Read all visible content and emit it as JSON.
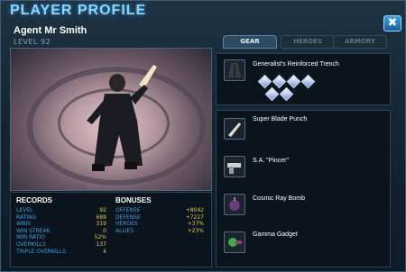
{
  "header": {
    "title": "PLAYER PROFILE",
    "close_label": "✖"
  },
  "agent": {
    "name": "Agent Mr Smith",
    "level": "LEVEL 92"
  },
  "tabs": [
    {
      "label": "GEAR",
      "active": true
    },
    {
      "label": "HEROES",
      "active": false
    },
    {
      "label": "ARMORY",
      "active": false
    }
  ],
  "records": {
    "heading": "RECORDS",
    "rows": [
      {
        "label": "LEVEL",
        "value": "92"
      },
      {
        "label": "RATING",
        "value": "689"
      },
      {
        "label": "WINS",
        "value": "319"
      },
      {
        "label": "WIN STREAK",
        "value": "0"
      },
      {
        "label": "WIN RATIO",
        "value": "52%"
      },
      {
        "label": "OVERKILLS",
        "value": "137"
      },
      {
        "label": "TRIPLE OVERKILLS",
        "value": "4"
      }
    ]
  },
  "bonuses": {
    "heading": "BONUSES",
    "rows": [
      {
        "label": "OFFENSE",
        "value": "+8042"
      },
      {
        "label": "DEFENSE",
        "value": "+7227"
      },
      {
        "label": "HEROES",
        "value": "+37%"
      },
      {
        "label": "ALLIES",
        "value": "+23%"
      }
    ]
  },
  "gear": {
    "armor": {
      "name": "Generalist's Reinforced Trench",
      "icon": "trench-coat-icon",
      "gems": 6
    },
    "items": [
      {
        "name": "Super Blade Punch",
        "icon": "blade-icon"
      },
      {
        "name": "S.A. \"Pincer\"",
        "icon": "pistol-icon"
      },
      {
        "name": "Cosmic Ray Bomb",
        "icon": "bomb-icon"
      },
      {
        "name": "Gamma Gadget",
        "icon": "gadget-icon"
      }
    ]
  },
  "colors": {
    "accent": "#3f9fe6",
    "value": "#e8c64a",
    "title": "#8fd6ff"
  }
}
